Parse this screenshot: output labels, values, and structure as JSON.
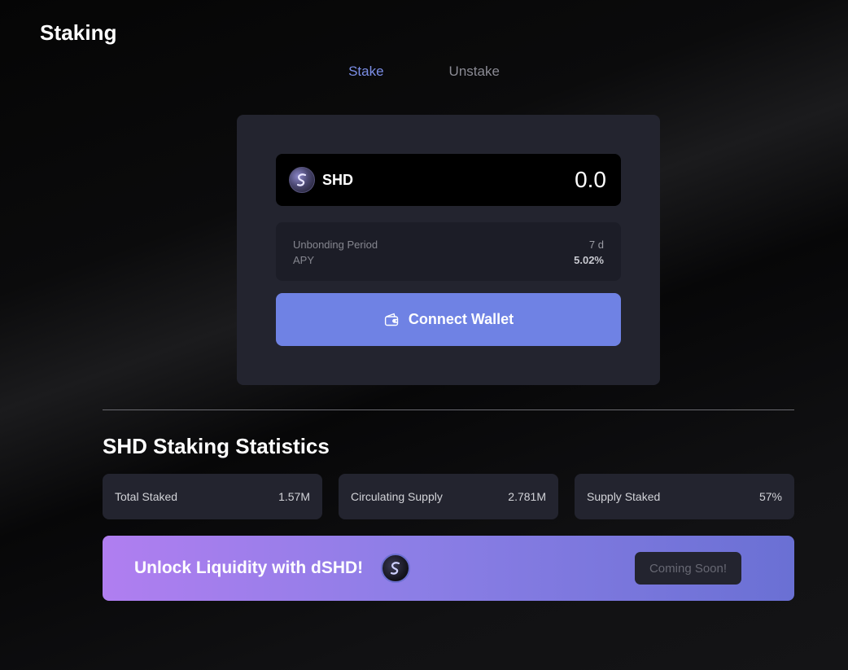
{
  "page": {
    "title": "Staking"
  },
  "tabs": [
    {
      "label": "Stake",
      "active": true
    },
    {
      "label": "Unstake",
      "active": false
    }
  ],
  "stake_card": {
    "token": {
      "symbol": "SHD",
      "icon": "shade-token-icon"
    },
    "amount_value": "0.0",
    "info": {
      "unbonding_label": "Unbonding Period",
      "unbonding_value": "7 d",
      "apy_label": "APY",
      "apy_value": "5.02%"
    },
    "connect_button": {
      "label": "Connect Wallet",
      "icon": "wallet-icon"
    }
  },
  "stats": {
    "title": "SHD Staking Statistics",
    "items": [
      {
        "label": "Total Staked",
        "value": "1.57M"
      },
      {
        "label": "Circulating Supply",
        "value": "2.781M"
      },
      {
        "label": "Supply Staked",
        "value": "57%"
      }
    ]
  },
  "banner": {
    "text": "Unlock Liquidity with dSHD!",
    "icon": "dshd-token-icon",
    "button_label": "Coming Soon!"
  },
  "colors": {
    "accent": "#6f82e4",
    "active_tab": "#7b8ee6",
    "card": "#23242f",
    "banner_start": "#b07ef0",
    "banner_end": "#6a70d4"
  }
}
